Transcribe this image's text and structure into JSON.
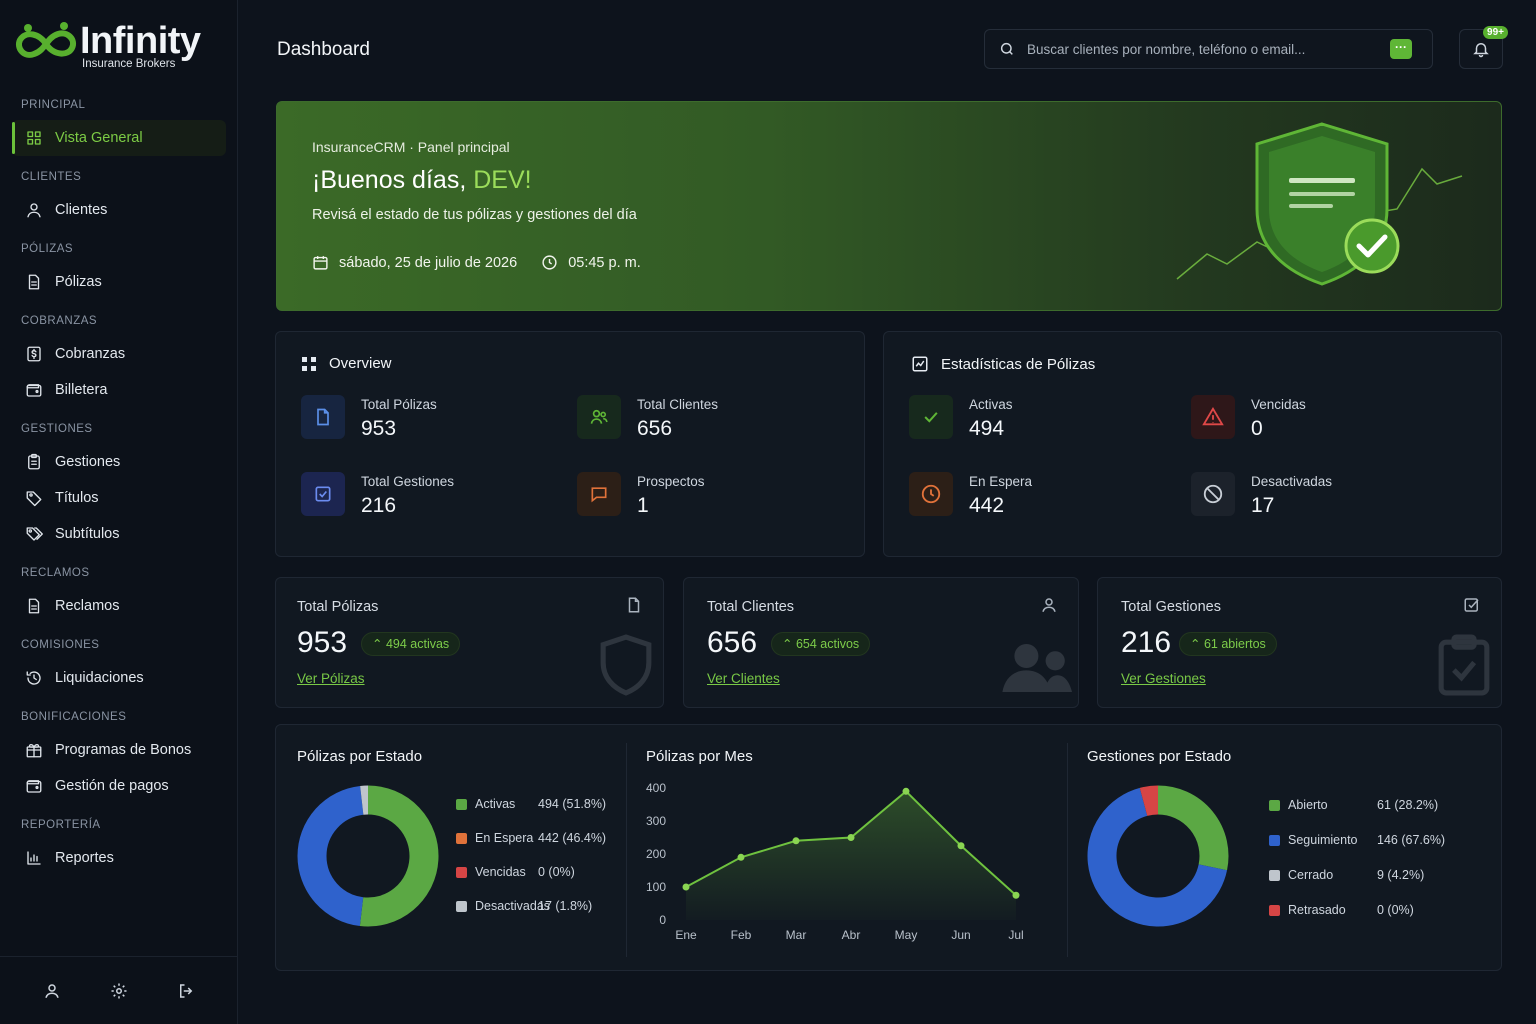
{
  "brand": {
    "name": "Infinity",
    "subtitle": "Insurance Brokers"
  },
  "sidebar": {
    "sections": [
      {
        "title": "PRINCIPAL",
        "items": [
          {
            "label": "Vista General",
            "icon": "grid-icon",
            "active": true
          }
        ]
      },
      {
        "title": "CLIENTES",
        "items": [
          {
            "label": "Clientes",
            "icon": "user-icon"
          }
        ]
      },
      {
        "title": "PÓLIZAS",
        "items": [
          {
            "label": "Pólizas",
            "icon": "document-icon"
          }
        ]
      },
      {
        "title": "COBRANZAS",
        "items": [
          {
            "label": "Cobranzas",
            "icon": "dollar-icon"
          },
          {
            "label": "Billetera",
            "icon": "wallet-icon"
          }
        ]
      },
      {
        "title": "GESTIONES",
        "items": [
          {
            "label": "Gestiones",
            "icon": "clipboard-icon"
          },
          {
            "label": "Títulos",
            "icon": "tag-icon"
          },
          {
            "label": "Subtítulos",
            "icon": "tags-icon"
          }
        ]
      },
      {
        "title": "RECLAMOS",
        "items": [
          {
            "label": "Reclamos",
            "icon": "document-icon"
          }
        ]
      },
      {
        "title": "COMISIONES",
        "items": [
          {
            "label": "Liquidaciones",
            "icon": "history-icon"
          }
        ]
      },
      {
        "title": "BONIFICACIONES",
        "items": [
          {
            "label": "Programas de Bonos",
            "icon": "gift-icon"
          },
          {
            "label": "Gestión de pagos",
            "icon": "wallet-icon"
          }
        ]
      },
      {
        "title": "REPORTERÍA",
        "items": [
          {
            "label": "Reportes",
            "icon": "report-icon"
          }
        ]
      }
    ]
  },
  "header": {
    "title": "Dashboard",
    "search_placeholder": "Buscar clientes por nombre, teléfono o email...",
    "notifications_badge": "99+"
  },
  "hero": {
    "breadcrumb": "InsuranceCRM · Panel principal",
    "greeting": "¡Buenos días, ",
    "user": "DEV!",
    "subtitle": "Revisá el estado de tus pólizas y gestiones del día",
    "date": "sábado, 25 de julio de 2026",
    "time": "05:45 p. m."
  },
  "overview": {
    "title": "Overview",
    "stats": [
      {
        "label": "Total Pólizas",
        "value": "953"
      },
      {
        "label": "Total Clientes",
        "value": "656"
      },
      {
        "label": "Total Gestiones",
        "value": "216"
      },
      {
        "label": "Prospectos",
        "value": "1"
      }
    ]
  },
  "policy_stats": {
    "title": "Estadísticas de Pólizas",
    "stats": [
      {
        "label": "Activas",
        "value": "494"
      },
      {
        "label": "Vencidas",
        "value": "0"
      },
      {
        "label": "En Espera",
        "value": "442"
      },
      {
        "label": "Desactivadas",
        "value": "17"
      }
    ]
  },
  "kpis": [
    {
      "label": "Total Pólizas",
      "value": "953",
      "pill": "494 activas",
      "link": "Ver Pólizas"
    },
    {
      "label": "Total Clientes",
      "value": "656",
      "pill": "654 activos",
      "link": "Ver Clientes"
    },
    {
      "label": "Total Gestiones",
      "value": "216",
      "pill": "61 abiertos",
      "link": "Ver Gestiones"
    }
  ],
  "colors": {
    "green": "#5ba844",
    "blue": "#2f62cc",
    "orange": "#e0723a",
    "red": "#d64545",
    "gray": "#bfc5cc"
  },
  "chart_data": [
    {
      "type": "pie",
      "title": "Pólizas por Estado",
      "categories": [
        "Activas",
        "En Espera",
        "Vencidas",
        "Desactivadas"
      ],
      "values": [
        494,
        442,
        0,
        17
      ],
      "value_labels": [
        "494 (51.8%)",
        "442 (46.4%)",
        "0 (0%)",
        "17 (1.8%)"
      ],
      "colors": [
        "#5ba844",
        "#2f62cc",
        "#d64545",
        "#bfc5cc"
      ],
      "legend_colors": [
        "#5ba844",
        "#e0723a",
        "#d64545",
        "#bfc5cc"
      ]
    },
    {
      "type": "area",
      "title": "Pólizas por Mes",
      "categories": [
        "Ene",
        "Feb",
        "Mar",
        "Abr",
        "May",
        "Jun",
        "Jul"
      ],
      "values": [
        100,
        190,
        240,
        250,
        390,
        225,
        75
      ],
      "ylim": [
        0,
        400
      ],
      "yticks": [
        0,
        100,
        200,
        300,
        400
      ],
      "grid": false
    },
    {
      "type": "pie",
      "title": "Gestiones por Estado",
      "categories": [
        "Abierto",
        "Seguimiento",
        "Cerrado",
        "Retrasado"
      ],
      "values": [
        61,
        146,
        9,
        0
      ],
      "value_labels": [
        "61 (28.2%)",
        "146 (67.6%)",
        "9 (4.2%)",
        "0 (0%)"
      ],
      "colors": [
        "#5ba844",
        "#2f62cc",
        "#d64545",
        "#d64545"
      ],
      "legend_colors": [
        "#5ba844",
        "#2f62cc",
        "#bfc5cc",
        "#d64545"
      ]
    }
  ]
}
